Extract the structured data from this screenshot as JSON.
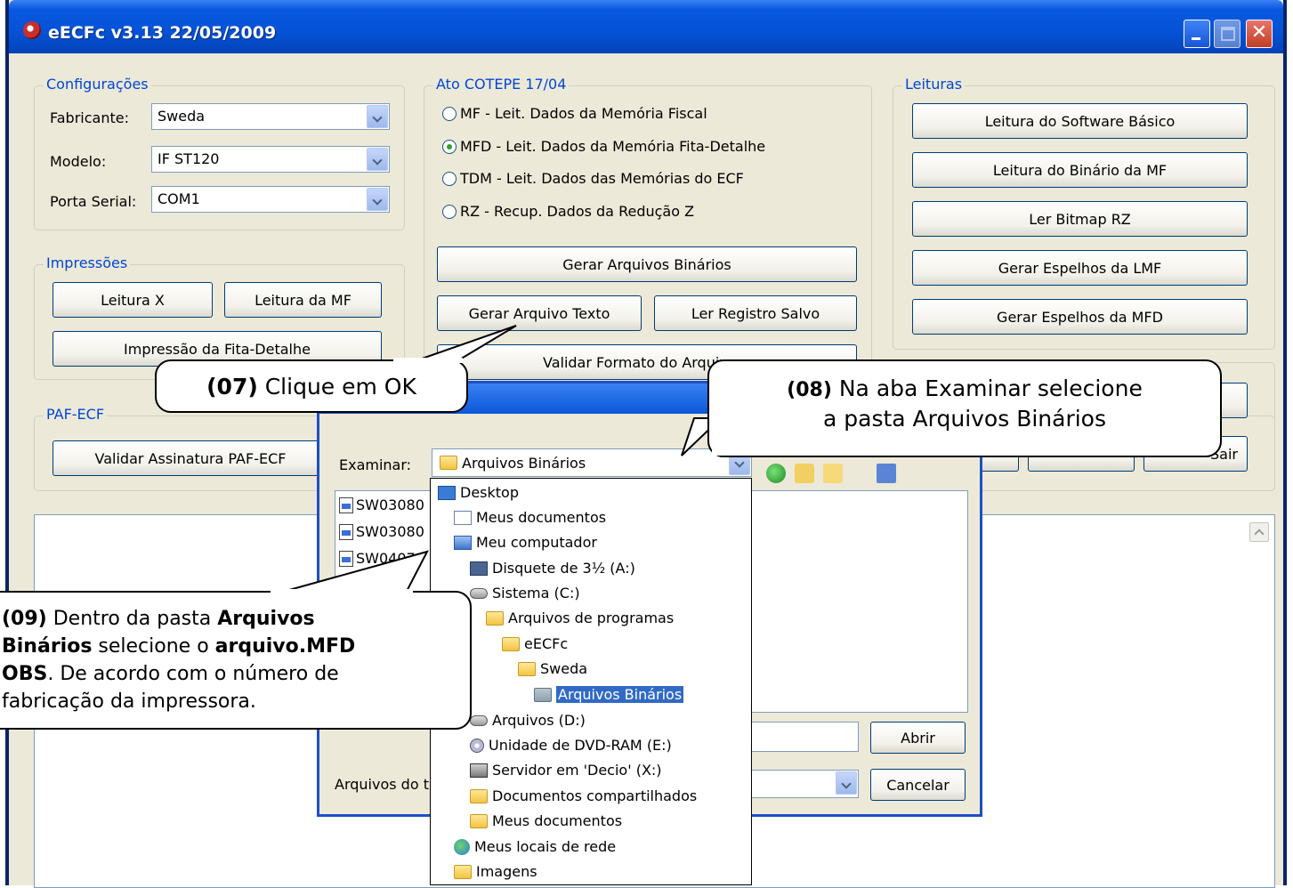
{
  "window": {
    "title": "eECFc v3.13  22/05/2009",
    "controls": {
      "minimize": "minimize",
      "maximize": "maximize",
      "close": "✕"
    }
  },
  "config": {
    "legend": "Configurações",
    "fabricante_label": "Fabricante:",
    "fabricante_value": "Sweda",
    "modelo_label": "Modelo:",
    "modelo_value": "IF ST120",
    "porta_label": "Porta Serial:",
    "porta_value": "COM1"
  },
  "ato": {
    "legend": "Ato COTEPE 17/04",
    "options": [
      {
        "label": "MF - Leit. Dados da Memória Fiscal",
        "selected": false
      },
      {
        "label": "MFD - Leit. Dados da Memória Fita-Detalhe",
        "selected": true
      },
      {
        "label": "TDM - Leit. Dados das Memórias do ECF",
        "selected": false
      },
      {
        "label": "RZ - Recup. Dados da Redução Z",
        "selected": false
      }
    ],
    "btn_gerar_binarios": "Gerar Arquivos Binários",
    "btn_gerar_texto": "Gerar Arquivo Texto",
    "btn_ler_registro": "Ler Registro Salvo",
    "btn_validar_formato": "Validar Formato do Arquivo"
  },
  "leituras": {
    "legend": "Leituras",
    "buttons": [
      "Leitura do Software Básico",
      "Leitura do Binário da MF",
      "Ler Bitmap RZ",
      "Gerar Espelhos da LMF",
      "Gerar Espelhos da MFD"
    ],
    "partial_button": "Sair"
  },
  "impressoes": {
    "legend": "Impressões",
    "btn_leitura_x": "Leitura X",
    "btn_leitura_mf": "Leitura da MF",
    "btn_fita_detalhe": "Impressão da Fita-Detalhe"
  },
  "paf": {
    "legend": "PAF-ECF",
    "btn_validar": "Validar Assinatura PAF-ECF"
  },
  "dialog": {
    "examinar_label": "Examinar:",
    "examinar_value": "Arquivos Binários",
    "files": [
      "SW03080",
      "SW03080",
      "SW0407"
    ],
    "tipo_label": "Arquivos do t",
    "btn_abrir": "Abrir",
    "btn_cancelar": "Cancelar"
  },
  "dropdown": {
    "items": [
      {
        "label": "Desktop",
        "icon": "desktop-icon"
      },
      {
        "label": "Meus documentos",
        "icon": "documents-icon"
      },
      {
        "label": "Meu computador",
        "icon": "computer-icon"
      },
      {
        "label": "Disquete de 3½ (A:)",
        "icon": "floppy-icon"
      },
      {
        "label": "Sistema (C:)",
        "icon": "drive-icon"
      },
      {
        "label": "Arquivos de programas",
        "icon": "folder-icon"
      },
      {
        "label": "eECFc",
        "icon": "folder-icon"
      },
      {
        "label": "Sweda",
        "icon": "folder-icon"
      },
      {
        "label": "Arquivos Binários",
        "icon": "folder-open-icon"
      },
      {
        "label": "Arquivos (D:)",
        "icon": "drive-icon"
      },
      {
        "label": "Unidade de DVD-RAM (E:)",
        "icon": "dvd-icon"
      },
      {
        "label": "Servidor em 'Decio' (X:)",
        "icon": "network-drive-icon"
      },
      {
        "label": "Documentos compartilhados",
        "icon": "folder-icon"
      },
      {
        "label": "Meus documentos",
        "icon": "folder-icon"
      },
      {
        "label": "Meus locais de rede",
        "icon": "network-icon"
      },
      {
        "label": "Imagens",
        "icon": "folder-icon"
      }
    ]
  },
  "callouts": {
    "c07_num": "(07)",
    "c07_text": " Clique em OK",
    "c08_num": "(08)",
    "c08_text": " Na aba Examinar selecione",
    "c08_line2": "a pasta Arquivos Binários",
    "c09_num": "(09)",
    "c09_t1": " Dentro da pasta ",
    "c09_b1": "Arquivos",
    "c09_b2": "Binários",
    "c09_t2": " selecione o ",
    "c09_b3": "arquivo.MFD",
    "c09_b4": "OBS",
    "c09_t3": ". De acordo com o número de",
    "c09_t4": "fabricação da impressora."
  }
}
